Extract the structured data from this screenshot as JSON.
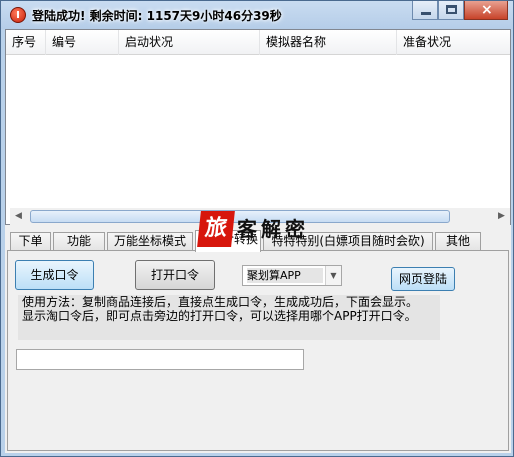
{
  "window": {
    "title": "登陆成功! 剩余时间: 1157天9小时46分39秒",
    "controls": {
      "minimize": "minimize",
      "maximize": "maximize",
      "close": "×"
    }
  },
  "list": {
    "columns": [
      "序号",
      "编号",
      "启动状况",
      "模拟器名称",
      "准备状况"
    ],
    "rows": []
  },
  "tabs": [
    {
      "label": "下单"
    },
    {
      "label": "功能"
    },
    {
      "label": "万能坐标模式"
    },
    {
      "label": "淘口令转换",
      "active": true
    },
    {
      "label": "特特特别(白嫖项目随时会砍)"
    },
    {
      "label": "其他"
    }
  ],
  "panel": {
    "generate_button": "生成口令",
    "open_button": "打开口令",
    "app_select_value": "聚划算APP",
    "web_login_button": "网页登陆",
    "help_line1": "使用方法：复制商品连接后，直接点生成口令，生成成功后，下面会显示。",
    "help_line2": "显示淘口令后，即可点击旁边的打开口令，可以选择用哪个APP打开口令。",
    "output_value": ""
  },
  "watermark": {
    "seal": "旅",
    "text": "客解密"
  },
  "colors": {
    "window_frame": "#b9d1ea",
    "close_button": "#c7432a",
    "watermark_red": "#d7160c"
  },
  "icons": [
    "app-icon",
    "minimize-icon",
    "maximize-icon",
    "close-icon",
    "scroll-left-icon",
    "scroll-right-icon",
    "dropdown-arrow-icon"
  ]
}
